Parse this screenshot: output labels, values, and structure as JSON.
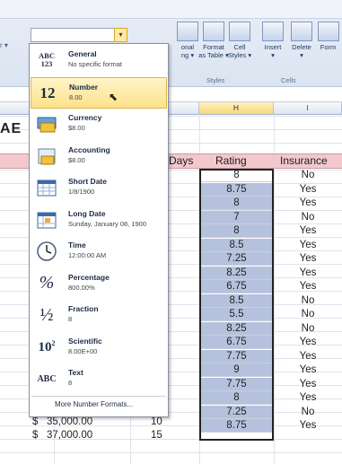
{
  "number_format_box": {
    "value": "",
    "arrow": "▾"
  },
  "ribbon": {
    "left_caption": "r ▾",
    "buttons": [
      {
        "label": "onal\nng ▾",
        "id": "conditional"
      },
      {
        "label": "Format\nas Table ▾",
        "id": "format-table"
      },
      {
        "label": "Cell\nStyles ▾",
        "id": "cell-styles"
      },
      {
        "label": "Insert\n▾",
        "id": "insert"
      },
      {
        "label": "Delete\n▾",
        "id": "delete"
      },
      {
        "label": "Form",
        "id": "format"
      }
    ],
    "groups": {
      "styles": "Styles",
      "cells": "Cells"
    }
  },
  "columns": {
    "h": "H",
    "i": "I"
  },
  "sheet": {
    "title_fragment": "AE",
    "headers": {
      "days": "Days",
      "rating": "Rating",
      "insurance": "Insurance"
    },
    "rating_values": [
      "8",
      "8.75",
      "8",
      "7",
      "8",
      "8.5",
      "7.25",
      "8.25",
      "6.75",
      "8.5",
      "5.5",
      "8.25",
      "6.75",
      "7.75",
      "9",
      "7.75",
      "8",
      "7.25",
      "8.75"
    ],
    "insurance_values": [
      "No",
      "Yes",
      "Yes",
      "No",
      "Yes",
      "Yes",
      "Yes",
      "Yes",
      "Yes",
      "No",
      "No",
      "No",
      "Yes",
      "Yes",
      "Yes",
      "Yes",
      "Yes",
      "No",
      "Yes"
    ],
    "bottom_rows": [
      {
        "currency": "$",
        "amount": "35,000.00",
        "days": "10"
      },
      {
        "currency": "$",
        "amount": "37,000.00",
        "days": "15"
      }
    ]
  },
  "dropdown": {
    "items": [
      {
        "name": "General",
        "sample": "No specific format",
        "icon": "general-icon",
        "glyph": "ABC\n123"
      },
      {
        "name": "Number",
        "sample": "8.00",
        "icon": "number-icon",
        "glyph": "12"
      },
      {
        "name": "Currency",
        "sample": "$8.00",
        "icon": "currency-icon",
        "glyph": ""
      },
      {
        "name": "Accounting",
        "sample": "$8.00",
        "icon": "accounting-icon",
        "glyph": ""
      },
      {
        "name": "Short Date",
        "sample": "1/8/1900",
        "icon": "short-date-icon",
        "glyph": ""
      },
      {
        "name": "Long Date",
        "sample": "Sunday, January 08, 1900",
        "icon": "long-date-icon",
        "glyph": ""
      },
      {
        "name": "Time",
        "sample": "12:00:00 AM",
        "icon": "time-icon",
        "glyph": ""
      },
      {
        "name": "Percentage",
        "sample": "800.00%",
        "icon": "percentage-icon",
        "glyph": "%"
      },
      {
        "name": "Fraction",
        "sample": "8",
        "icon": "fraction-icon",
        "glyph": "½"
      },
      {
        "name": "Scientific",
        "sample": "8.00E+00",
        "icon": "scientific-icon",
        "glyph": "10²"
      },
      {
        "name": "Text",
        "sample": "8",
        "icon": "text-icon",
        "glyph": "ABC"
      }
    ],
    "selected_index": 1,
    "more": "More Number Formats..."
  }
}
